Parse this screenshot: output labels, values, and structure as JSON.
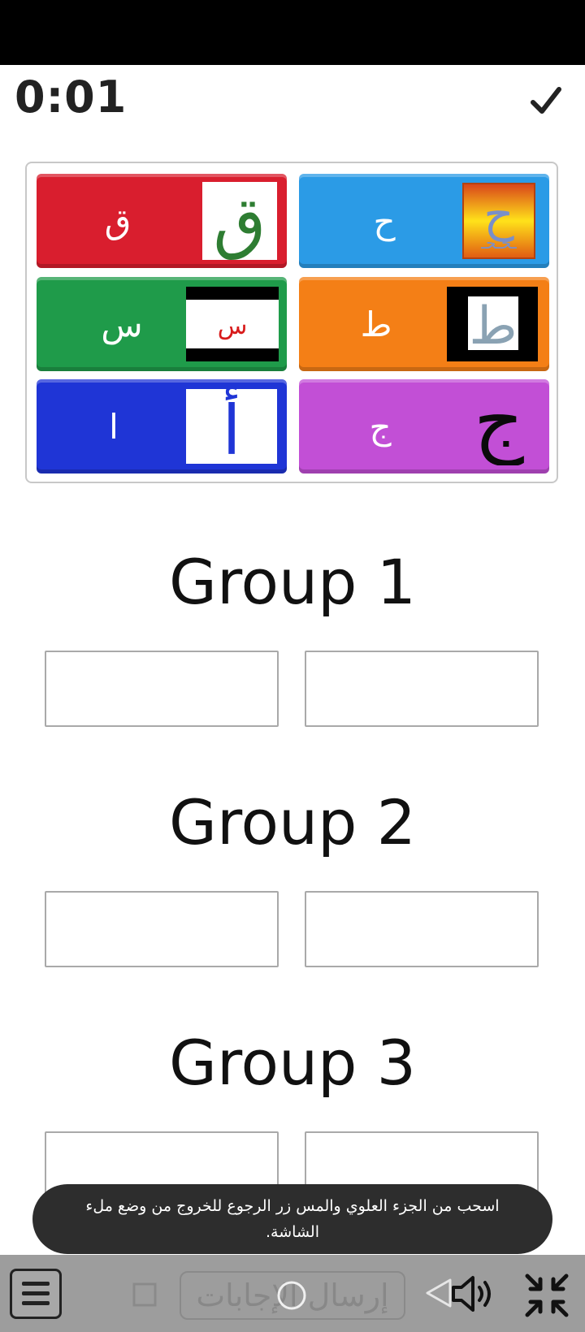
{
  "timer": "0:01",
  "cards": [
    {
      "label": "ح",
      "color": "#2b9be6",
      "image": "haa-tile"
    },
    {
      "label": "ق",
      "color": "#d91e2e",
      "image": "qaf-tile"
    },
    {
      "label": "ط",
      "color": "#f47f16",
      "image": "taa-tile"
    },
    {
      "label": "س",
      "color": "#1f9b4a",
      "image": "seen-tile"
    },
    {
      "label": "ج",
      "color": "#c24fd6",
      "image": "jeem-tile"
    },
    {
      "label": "ا",
      "color": "#1f35d6",
      "image": "alif-tile"
    }
  ],
  "card_images": {
    "haa": "ح",
    "qaf": "ق",
    "taa": "ط",
    "seen": "س",
    "jeem": "ج",
    "alif": "أ"
  },
  "groups": [
    {
      "title": "Group 1"
    },
    {
      "title": "Group 2"
    },
    {
      "title": "Group 3"
    }
  ],
  "toast": {
    "text": "اسحب من الجزء العلوي والمس زر الرجوع للخروج من وضع ملء الشاشة."
  },
  "bottom_bar": {
    "submit_label": "إرسال الإجابات",
    "icons": [
      "menu-icon",
      "stop-icon",
      "submit-button",
      "back-icon",
      "volume-icon",
      "exit-fullscreen-icon"
    ]
  }
}
